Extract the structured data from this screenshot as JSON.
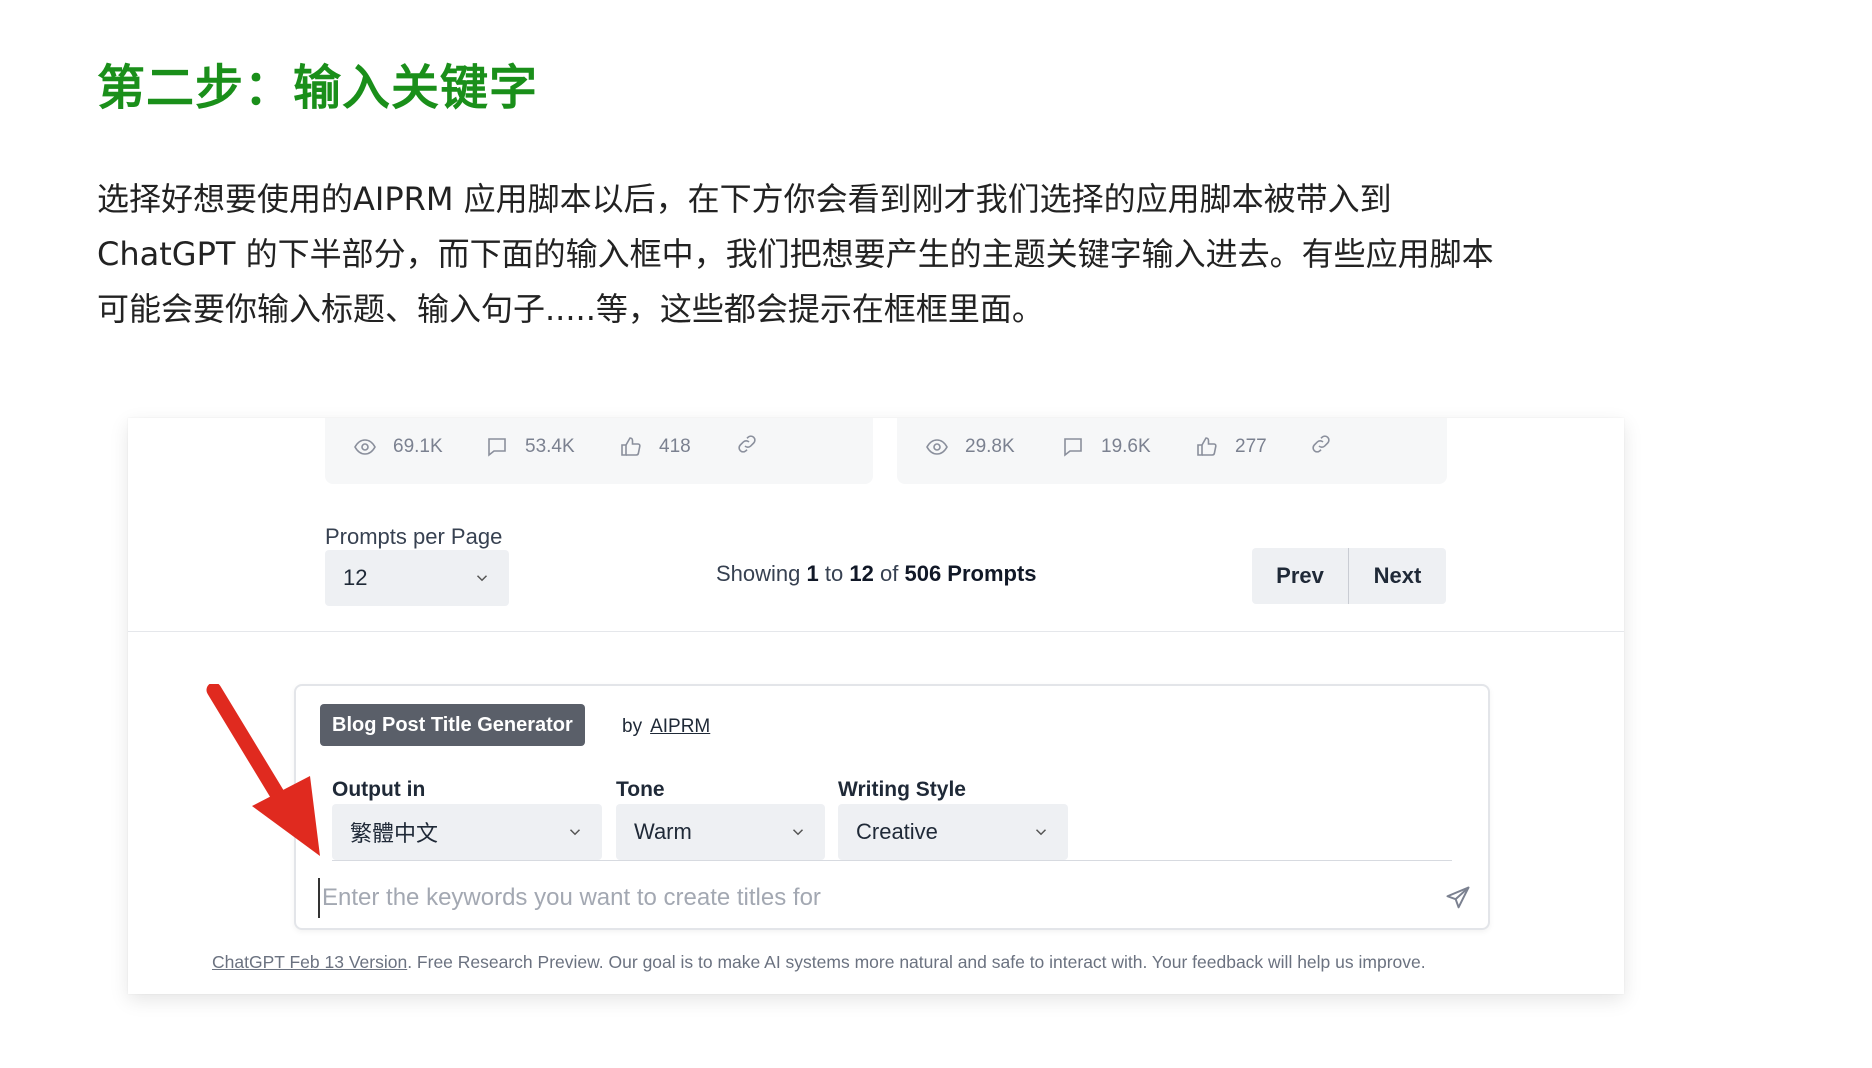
{
  "article": {
    "heading": "第二步：输入关键字",
    "paragraph_lines": [
      "选择好想要使用的AIPRM 应用脚本以后，在下方你会看到刚才我们选择的应用脚本被带入到",
      "ChatGPT 的下半部分，而下面的输入框中，我们把想要产生的主题关键字输入进去。有些应用脚本",
      "可能会要你输入标题、输入句子.....等，这些都会提示在框框里面。"
    ]
  },
  "cards": [
    {
      "views": "69.1K",
      "comments": "53.4K",
      "likes": "418"
    },
    {
      "views": "29.8K",
      "comments": "19.6K",
      "likes": "277"
    }
  ],
  "pagination": {
    "per_page_label": "Prompts per Page",
    "per_page_value": "12",
    "showing_prefix": "Showing",
    "showing_from": "1",
    "showing_to_word": "to",
    "showing_to": "12",
    "showing_of_word": "of",
    "showing_total": "506 Prompts",
    "prev_label": "Prev",
    "next_label": "Next"
  },
  "composer": {
    "template_tag": "Blog Post Title Generator",
    "by_label": "by",
    "author": "AIPRM",
    "output_label": "Output in",
    "output_value": "繁體中文",
    "tone_label": "Tone",
    "tone_value": "Warm",
    "style_label": "Writing Style",
    "style_value": "Creative",
    "input_placeholder": "Enter the keywords you want to create titles for"
  },
  "footer": {
    "version_link": "ChatGPT Feb 13 Version",
    "text": ". Free Research Preview. Our goal is to make AI systems more natural and safe to interact with. Your feedback will help us improve."
  },
  "colors": {
    "heading_green": "#1a8f1a",
    "arrow_red": "#e02a1f",
    "tag_bg": "#5a5f69"
  },
  "icons": [
    "eye-icon",
    "comment-icon",
    "thumbs-up-icon",
    "link-icon",
    "chevron-down-icon",
    "send-icon",
    "red-arrow-icon"
  ]
}
